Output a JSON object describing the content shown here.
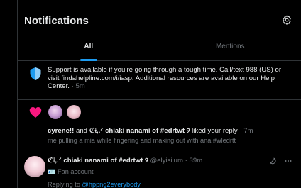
{
  "header": {
    "title": "Notifications"
  },
  "tabs": [
    {
      "label": "All"
    },
    {
      "label": "Mentions"
    }
  ],
  "support": {
    "message": "Support is available if you’re going through a tough time. Call/text 988 (US) or visit findahelpline.com/i/iasp. Additional resources are available on our Help Center.",
    "time": "· 5m"
  },
  "like": {
    "user1": "cyrene!!",
    "and": "and",
    "user2": "ℭ𝔦,.ᐟ chiaki nanami of #edrtwt ୨",
    "action": "liked your reply",
    "time": "· 7m",
    "snippet": "me pulling a mia while fingering and making out with ana #wledrtt"
  },
  "tweet": {
    "name": "ℭ𝔦,.ᐟ chiaki nanami of #edrtwt ୨",
    "handle": "@elyisiium",
    "time": "· 39m",
    "fan": "Fan account",
    "replying_prefix": "Replying to",
    "replying_handle": "@hppng2everybody"
  },
  "colors": {
    "accent": "#1d9bf0",
    "heart": "#f91880"
  },
  "icons": [
    "gear-icon",
    "shield-icon",
    "heart-icon",
    "grok-icon",
    "more-icon",
    "fan-badge-icon"
  ]
}
